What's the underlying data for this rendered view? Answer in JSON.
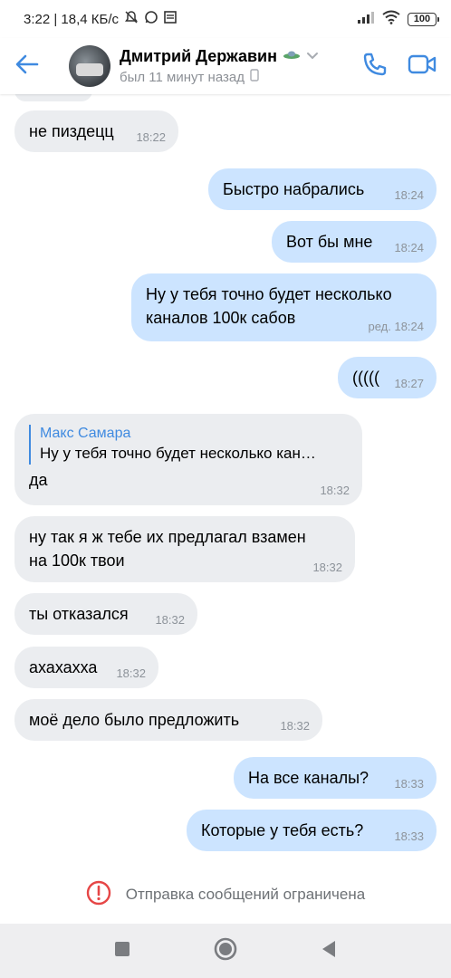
{
  "status_bar": {
    "time_speed": "3:22 | 18,4 КБ/с",
    "battery": "100"
  },
  "header": {
    "name": "Дмитрий Державин",
    "status": "был 11 минут назад"
  },
  "messages": [
    {
      "text": "не пиздецц",
      "time": "18:22"
    },
    {
      "text": "Быстро набрались",
      "time": "18:24"
    },
    {
      "text": "Вот бы мне",
      "time": "18:24"
    },
    {
      "text_line1": "Ну у тебя точно будет несколько",
      "text_line2": "каналов 100к сабов",
      "time": "ред. 18:24"
    },
    {
      "text": "(((((",
      "time": "18:27"
    },
    {
      "reply_name": "Макс Самара",
      "reply_text": "Ну у тебя точно будет несколько кан…",
      "text": "да",
      "time": "18:32"
    },
    {
      "text_line1": "ну так я ж тебе их предлагал взамен",
      "text_line2": "на 100к твои",
      "time": "18:32"
    },
    {
      "text": "ты отказался",
      "time": "18:32"
    },
    {
      "text": "ахахахха",
      "time": "18:32"
    },
    {
      "text": "моё дело было предложить",
      "time": "18:32"
    },
    {
      "text": "На все каналы?",
      "time": "18:33"
    },
    {
      "text": "Которые у тебя есть?",
      "time": "18:33"
    }
  ],
  "restriction_text": "Отправка сообщений ограничена",
  "colors": {
    "accent": "#3f8ae0",
    "incoming_bubble": "#ebedf0",
    "outgoing_bubble": "#cce4ff",
    "warning": "#e64646"
  }
}
